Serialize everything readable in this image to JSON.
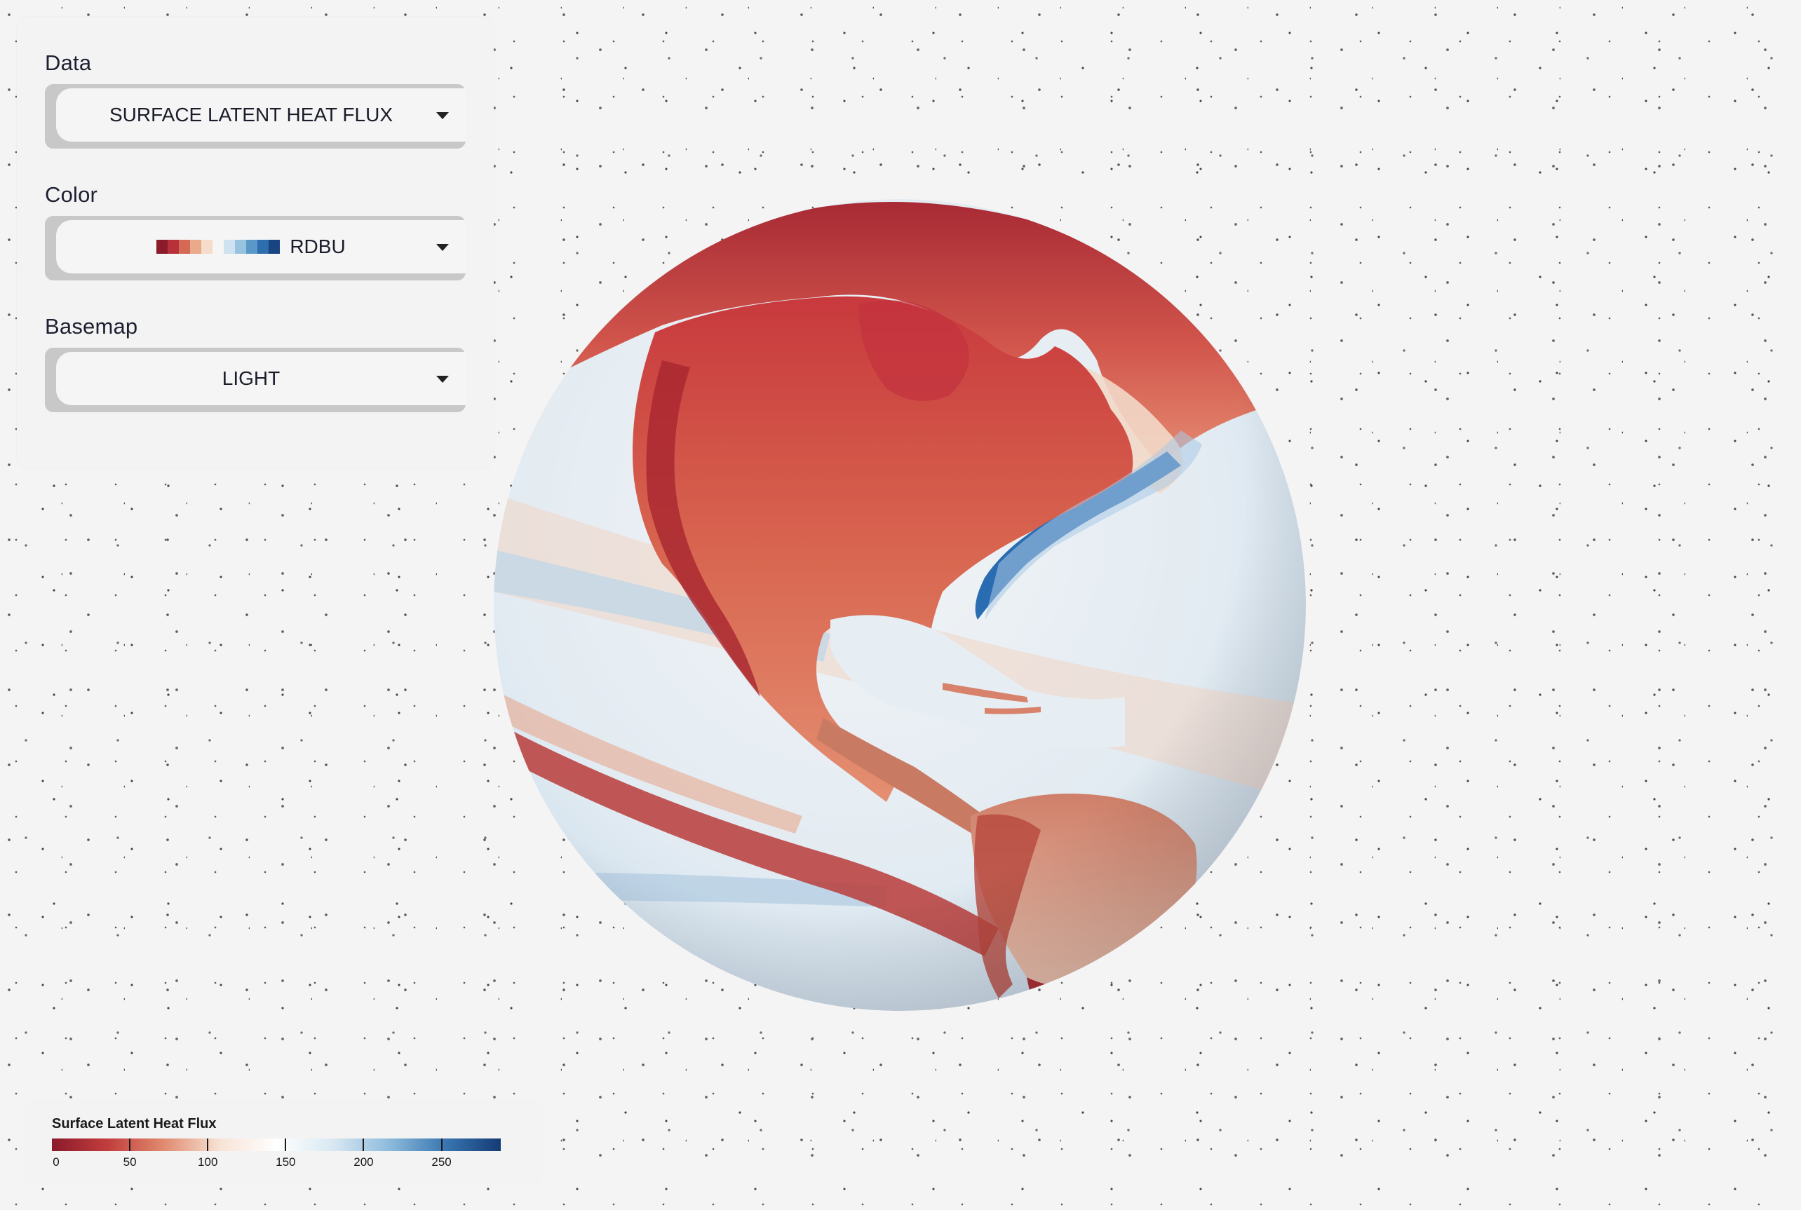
{
  "controls": {
    "data": {
      "label": "Data",
      "value": "SURFACE LATENT HEAT FLUX"
    },
    "color": {
      "label": "Color",
      "value": "RDBU",
      "swatch_colors": [
        "#8b1a2b",
        "#b8303a",
        "#d46a55",
        "#e9a98b",
        "#f6dccb",
        "#ffffff",
        "#cfe2ef",
        "#98c3df",
        "#5a98c8",
        "#2f6eae",
        "#18447f"
      ]
    },
    "basemap": {
      "label": "Basemap",
      "value": "LIGHT"
    }
  },
  "legend": {
    "title": "Surface Latent Heat Flux",
    "ticks": [
      {
        "value": 0,
        "label": "0"
      },
      {
        "value": 50,
        "label": "50"
      },
      {
        "value": 100,
        "label": "100"
      },
      {
        "value": 150,
        "label": "150"
      },
      {
        "value": 200,
        "label": "200"
      },
      {
        "value": 250,
        "label": "250"
      }
    ],
    "range": [
      0,
      288
    ],
    "gradient_colors": [
      "#8b1a2b",
      "#c23e3e",
      "#e08b6f",
      "#f7e3d6",
      "#ffffff",
      "#d9e8f2",
      "#8fbcdc",
      "#3a77b2",
      "#143b74"
    ]
  }
}
